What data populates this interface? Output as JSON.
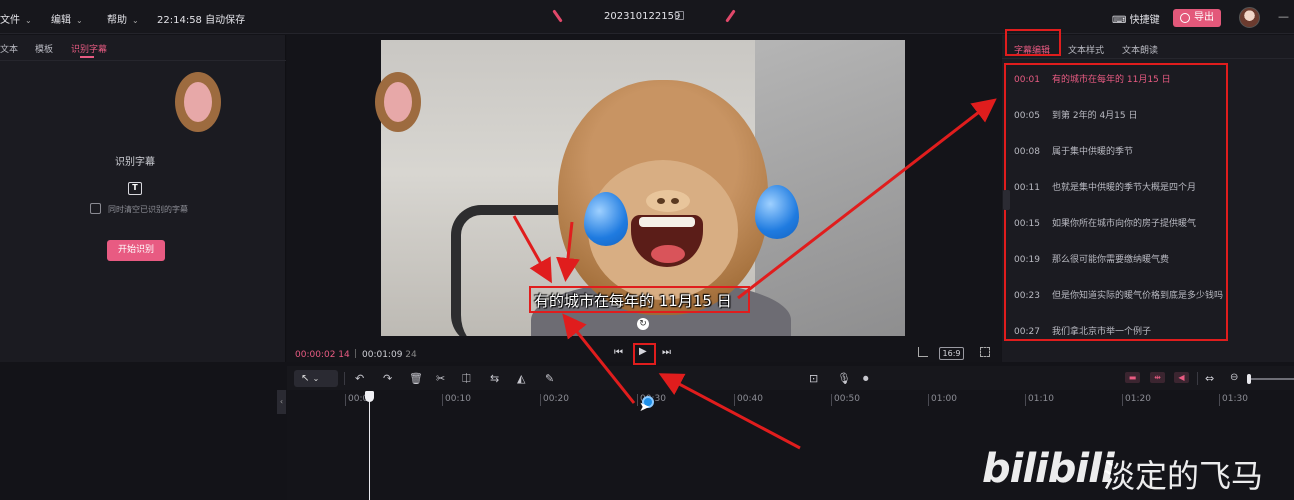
{
  "menu": {
    "file": "文件",
    "edit": "编辑",
    "help": "帮助",
    "autosave": "22:14:58 自动保存"
  },
  "project": {
    "title": "202310122159"
  },
  "topbar": {
    "shortcut": "快捷键",
    "export": "导出"
  },
  "left_tabs": [
    "文本",
    "模板",
    "识别字幕"
  ],
  "ocr_panel": {
    "title": "识别字幕",
    "checkbox_label": "同时清空已识别的字幕",
    "start_button": "开始识别"
  },
  "video": {
    "subtitle": "有的城市在每年的 11月15 日"
  },
  "player": {
    "current": "00:00:02",
    "current_frames": "14",
    "separator": "|",
    "total": "00:01:09",
    "total_frames": "24",
    "ratio": "16:9"
  },
  "right_tabs": [
    "字幕编辑",
    "文本样式",
    "文本朗读"
  ],
  "subtitles": [
    {
      "time": "00:01",
      "text": "有的城市在每年的 11月15 日"
    },
    {
      "time": "00:05",
      "text": "到第 2年的 4月15 日"
    },
    {
      "time": "00:08",
      "text": "属于集中供暖的季节"
    },
    {
      "time": "00:11",
      "text": "也就是集中供暖的季节大概是四个月"
    },
    {
      "time": "00:15",
      "text": "如果你所在城市向你的房子提供暖气"
    },
    {
      "time": "00:19",
      "text": "那么很可能你需要缴纳暖气费"
    },
    {
      "time": "00:23",
      "text": "但是你知道实际的暖气价格到底是多少钱吗"
    },
    {
      "time": "00:27",
      "text": "我们拿北京市举一个例子"
    }
  ],
  "timeline": {
    "ticks": [
      "00:00",
      "00:10",
      "00:20",
      "00:30",
      "00:40",
      "00:50",
      "01:00",
      "01:10",
      "01:20",
      "01:30"
    ]
  },
  "watermark": {
    "logo": "bilibili",
    "name": "淡定的飞马"
  },
  "colors": {
    "accent": "#e85b82",
    "annotation_red": "#e01d1d"
  }
}
